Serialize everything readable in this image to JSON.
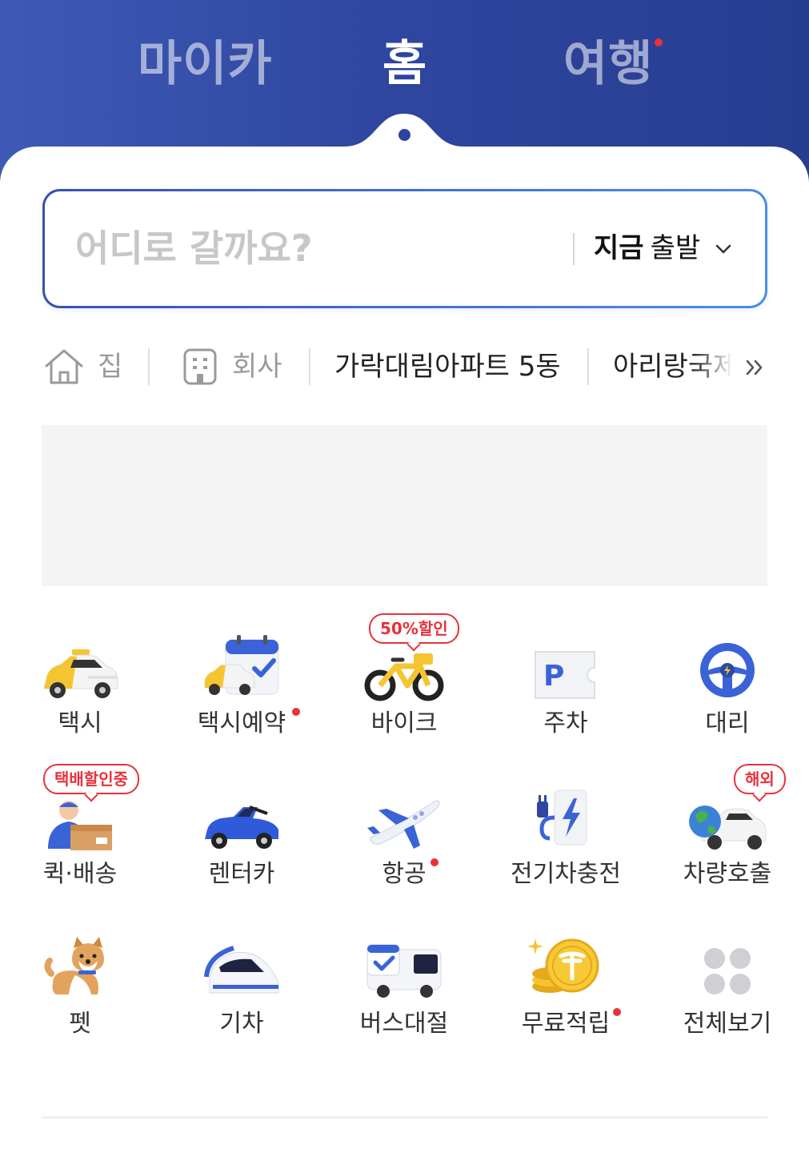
{
  "tabs": {
    "mycar": "마이카",
    "home": "홈",
    "travel": "여행"
  },
  "search": {
    "placeholder": "어디로 갈까요?",
    "depart_time": "지금",
    "depart_label": "출발"
  },
  "shortcuts": {
    "home": "집",
    "work": "회사",
    "place1": "가락대림아파트 5동",
    "place2": "아리랑국제",
    "more_icon": "double-chevron-right-icon"
  },
  "services": [
    {
      "label": "택시",
      "icon": "taxi-icon"
    },
    {
      "label": "택시예약",
      "icon": "taxi-reservation-icon",
      "dot": true
    },
    {
      "label": "바이크",
      "icon": "bike-icon",
      "badge": "50%할인"
    },
    {
      "label": "주차",
      "icon": "parking-icon"
    },
    {
      "label": "대리",
      "icon": "steering-wheel-icon"
    },
    {
      "label": "퀵·배송",
      "icon": "delivery-icon",
      "badge": "택배할인중"
    },
    {
      "label": "렌터카",
      "icon": "rental-car-icon"
    },
    {
      "label": "항공",
      "icon": "airplane-icon",
      "dot": true
    },
    {
      "label": "전기차충전",
      "icon": "ev-charger-icon"
    },
    {
      "label": "차량호출",
      "icon": "global-car-icon",
      "badge": "해외"
    },
    {
      "label": "펫",
      "icon": "pet-icon"
    },
    {
      "label": "기차",
      "icon": "train-icon"
    },
    {
      "label": "버스대절",
      "icon": "bus-charter-icon"
    },
    {
      "label": "무료적립",
      "icon": "coin-icon",
      "dot": true
    },
    {
      "label": "전체보기",
      "icon": "all-menu-icon"
    }
  ],
  "colors": {
    "header": "#2f47a0",
    "accent_red": "#e8313b",
    "brand_yellow": "#f5c431",
    "brand_blue": "#3a63d8"
  }
}
